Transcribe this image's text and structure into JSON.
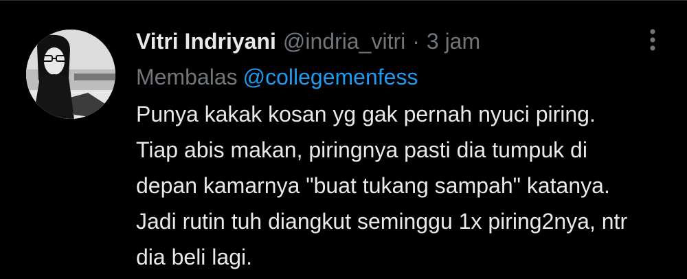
{
  "tweet": {
    "display_name": "Vitri Indriyani",
    "handle": "@indria_vitri",
    "separator": "·",
    "time": "3 jam",
    "reply_label": "Membalas",
    "reply_to": "@collegemenfess",
    "text": "Punya kakak kosan yg gak pernah nyuci piring. Tiap abis makan, piringnya pasti dia tumpuk di depan kamarnya \"buat tukang sampah\" katanya. Jadi rutin tuh diangkut seminggu 1x piring2nya, ntr dia beli lagi."
  },
  "icons": {
    "more": "more-vertical-icon",
    "avatar": "avatar"
  },
  "colors": {
    "background": "#000000",
    "primary_text": "#e7e9ea",
    "secondary_text": "#71767b",
    "link": "#1d9bf0"
  }
}
